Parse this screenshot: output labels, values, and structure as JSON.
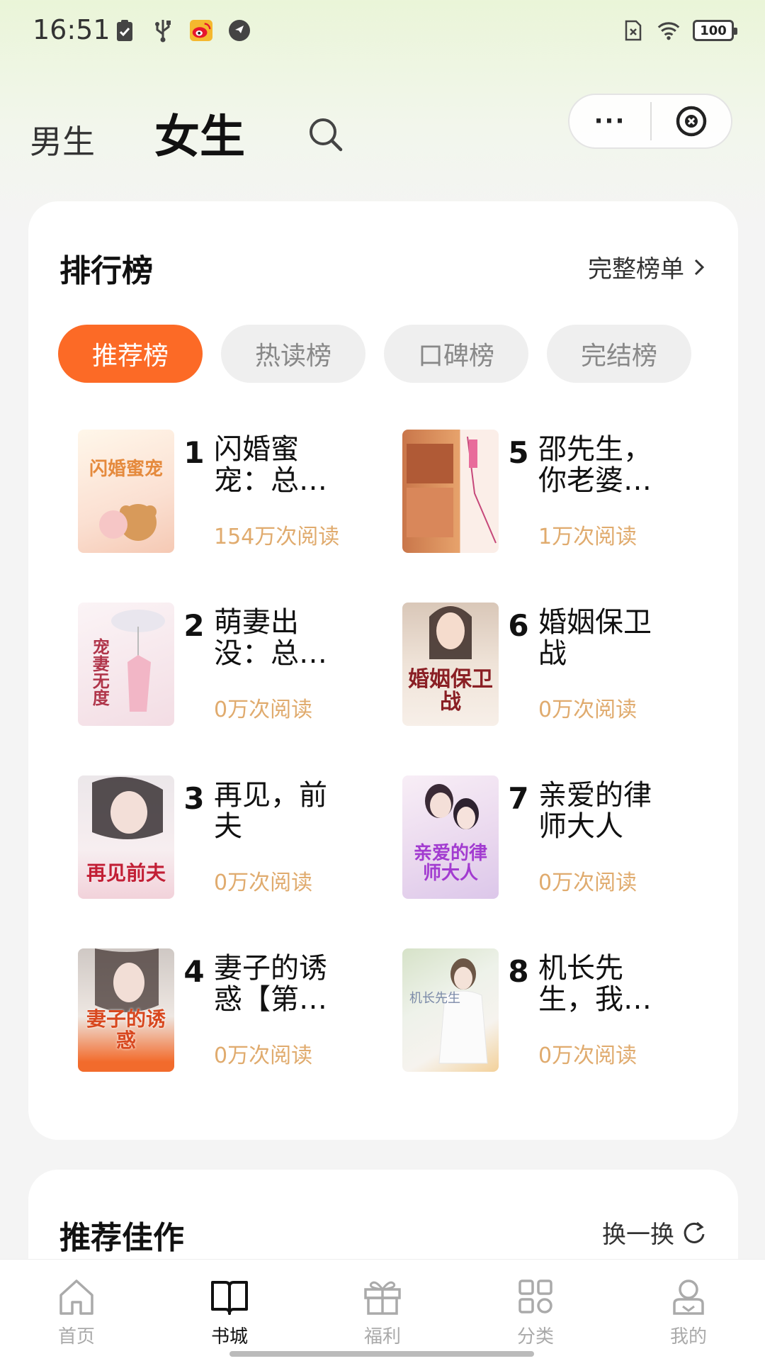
{
  "status_bar": {
    "time": "16:51",
    "battery": "100",
    "icons_left": [
      "clipboard-check-icon",
      "usb-icon",
      "weibo-icon",
      "navigation-icon"
    ],
    "icons_right": [
      "sim-missing-icon",
      "wifi-icon",
      "battery-icon"
    ]
  },
  "header": {
    "tab_male": "男生",
    "tab_female": "女生",
    "active_tab": "女生",
    "more_label": "···"
  },
  "ranking": {
    "title": "排行榜",
    "more": "完整榜单",
    "tabs": [
      {
        "label": "推荐榜",
        "active": true
      },
      {
        "label": "热读榜",
        "active": false
      },
      {
        "label": "口碑榜",
        "active": false
      },
      {
        "label": "完结榜",
        "active": false
      }
    ],
    "books": [
      {
        "rank": "1",
        "title": "闪婚蜜宠：总…",
        "reads": "154万次阅读",
        "cover_text": "闪婚蜜宠"
      },
      {
        "rank": "5",
        "title": "邵先生，你老婆…",
        "reads": "1万次阅读",
        "cover_text": ""
      },
      {
        "rank": "2",
        "title": "萌妻出没：总…",
        "reads": "0万次阅读",
        "cover_text": "宠妻无度"
      },
      {
        "rank": "6",
        "title": "婚姻保卫战",
        "reads": "0万次阅读",
        "cover_text": "婚姻保卫战"
      },
      {
        "rank": "3",
        "title": "再见，前夫",
        "reads": "0万次阅读",
        "cover_text": "再见前夫"
      },
      {
        "rank": "7",
        "title": "亲爱的律师大人",
        "reads": "0万次阅读",
        "cover_text": "亲爱的律师大人"
      },
      {
        "rank": "4",
        "title": "妻子的诱惑【第…",
        "reads": "0万次阅读",
        "cover_text": "妻子的诱惑"
      },
      {
        "rank": "8",
        "title": "机长先生，我…",
        "reads": "0万次阅读",
        "cover_text": "机长先生"
      }
    ]
  },
  "recommend": {
    "title": "推荐佳作",
    "refresh": "换一换"
  },
  "bottom_nav": [
    {
      "label": "首页",
      "icon": "home-icon",
      "active": false
    },
    {
      "label": "书城",
      "icon": "book-icon",
      "active": true
    },
    {
      "label": "福利",
      "icon": "gift-icon",
      "active": false
    },
    {
      "label": "分类",
      "icon": "category-icon",
      "active": false
    },
    {
      "label": "我的",
      "icon": "profile-icon",
      "active": false
    }
  ],
  "colors": {
    "accent": "#fc6a26",
    "reads": "#e0ab6e",
    "pill_inactive": "#efefef"
  }
}
